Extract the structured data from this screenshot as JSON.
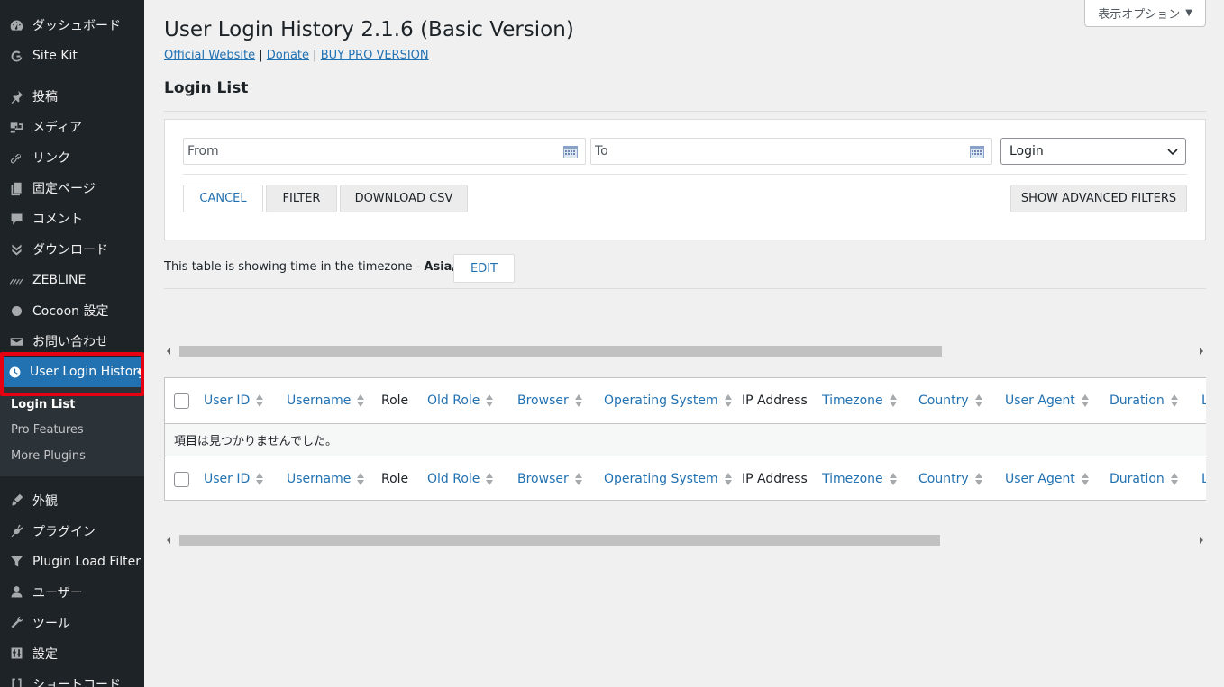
{
  "sidebar": {
    "items": [
      {
        "icon": "dashboard-icon",
        "label": "ダッシュボード"
      },
      {
        "icon": "google-g-icon",
        "label": "Site Kit"
      },
      {
        "icon": "pin-icon",
        "label": "投稿"
      },
      {
        "icon": "media-icon",
        "label": "メディア"
      },
      {
        "icon": "link-icon",
        "label": "リンク"
      },
      {
        "icon": "page-icon",
        "label": "固定ページ"
      },
      {
        "icon": "comment-icon",
        "label": "コメント"
      },
      {
        "icon": "download-icon",
        "label": "ダウンロード"
      },
      {
        "icon": "zebline-icon",
        "label": "ZEBLINE"
      },
      {
        "icon": "circle-icon",
        "label": "Cocoon 設定"
      },
      {
        "icon": "mail-icon",
        "label": "お問い合わせ"
      },
      {
        "icon": "clock-icon",
        "label": "User Login History"
      }
    ],
    "submenu": [
      "Login List",
      "Pro Features",
      "More Plugins"
    ],
    "items_bottom": [
      {
        "icon": "brush-icon",
        "label": "外観"
      },
      {
        "icon": "plugin-icon",
        "label": "プラグイン"
      },
      {
        "icon": "filter-icon",
        "label": "Plugin Load Filter"
      },
      {
        "icon": "user-icon",
        "label": "ユーザー"
      },
      {
        "icon": "wrench-icon",
        "label": "ツール"
      },
      {
        "icon": "settings-icon",
        "label": "設定"
      },
      {
        "icon": "shortcode-icon",
        "label": "ショートコード"
      }
    ]
  },
  "header": {
    "screen_options": "表示オプション",
    "title": "User Login History 2.1.6 (Basic Version)",
    "links": {
      "official": "Official Website",
      "donate": "Donate",
      "pro": "BUY PRO VERSION",
      "sep": "|"
    },
    "section": "Login List"
  },
  "filters": {
    "from_placeholder": "From",
    "to_placeholder": "To",
    "role_value": "Login",
    "cancel": "CANCEL",
    "filter": "FILTER",
    "download_csv": "DOWNLOAD CSV",
    "advanced": "SHOW ADVANCED FILTERS"
  },
  "timezone": {
    "text": "This table is showing time in the timezone - ",
    "zone": "Asia/Tokyo",
    "edit": "EDIT"
  },
  "table": {
    "columns": [
      "User ID",
      "Username",
      "Role",
      "Old Role",
      "Browser",
      "Operating System",
      "IP Address",
      "Timezone",
      "Country",
      "User Agent",
      "Duration",
      "L"
    ],
    "empty_message": "項目は見つかりませんでした。"
  },
  "colors": {
    "sidebar_bg": "#1d2327",
    "active_bg": "#2271b1",
    "highlight": "#e60012",
    "link": "#2271b1"
  }
}
